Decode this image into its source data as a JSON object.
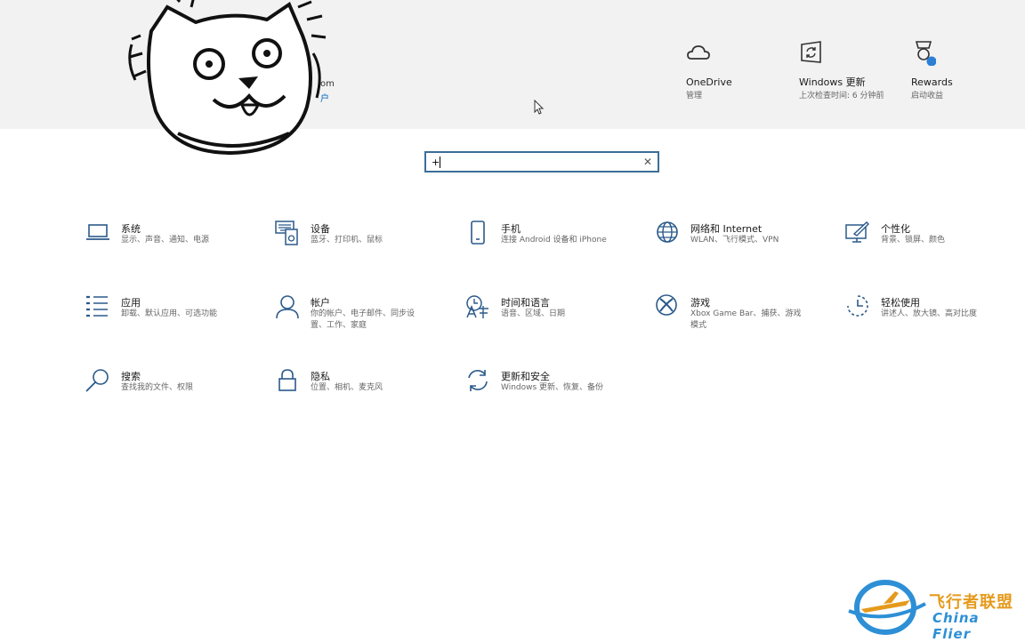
{
  "header": {
    "account_fragment_1": "om",
    "account_fragment_2": "户"
  },
  "quick_links": [
    {
      "title": "OneDrive",
      "sub": "管理",
      "icon": "cloud-icon"
    },
    {
      "title": "Windows 更新",
      "sub": "上次检查时间: 6 分钟前",
      "icon": "windows-update-icon"
    },
    {
      "title": "Rewards",
      "sub": "启动收益",
      "icon": "rewards-medal-icon"
    }
  ],
  "search": {
    "value": "+",
    "clear_icon": "✕"
  },
  "tiles": [
    {
      "title": "系统",
      "sub": "显示、声音、通知、电源",
      "icon": "laptop-icon"
    },
    {
      "title": "设备",
      "sub": "蓝牙、打印机、鼠标",
      "icon": "devices-icon"
    },
    {
      "title": "手机",
      "sub": "连接 Android 设备和 iPhone",
      "icon": "phone-icon"
    },
    {
      "title": "网络和 Internet",
      "sub": "WLAN、飞行模式、VPN",
      "icon": "globe-icon"
    },
    {
      "title": "个性化",
      "sub": "背景、锁屏、颜色",
      "icon": "personalization-icon"
    },
    {
      "title": "应用",
      "sub": "卸载、默认应用、可选功能",
      "icon": "apps-list-icon"
    },
    {
      "title": "帐户",
      "sub": "你的帐户、电子邮件、同步设置、工作、家庭",
      "icon": "person-icon"
    },
    {
      "title": "时间和语言",
      "sub": "语音、区域、日期",
      "icon": "time-language-icon"
    },
    {
      "title": "游戏",
      "sub": "Xbox Game Bar、捕获、游戏模式",
      "icon": "xbox-icon"
    },
    {
      "title": "轻松使用",
      "sub": "讲述人、放大镜、高对比度",
      "icon": "ease-of-access-icon"
    },
    {
      "title": "搜索",
      "sub": "查找我的文件、权限",
      "icon": "search-icon"
    },
    {
      "title": "隐私",
      "sub": "位置、相机、麦克风",
      "icon": "lock-icon"
    },
    {
      "title": "更新和安全",
      "sub": "Windows 更新、恢复、备份",
      "icon": "update-sync-icon"
    }
  ],
  "watermark": {
    "cn": "飞行者联盟",
    "en": "China Flier"
  },
  "colors": {
    "accent": "#3b6e98",
    "icon": "#2b5a8a",
    "topband": "#f2f2f2",
    "badge": "#2d7fd6"
  }
}
